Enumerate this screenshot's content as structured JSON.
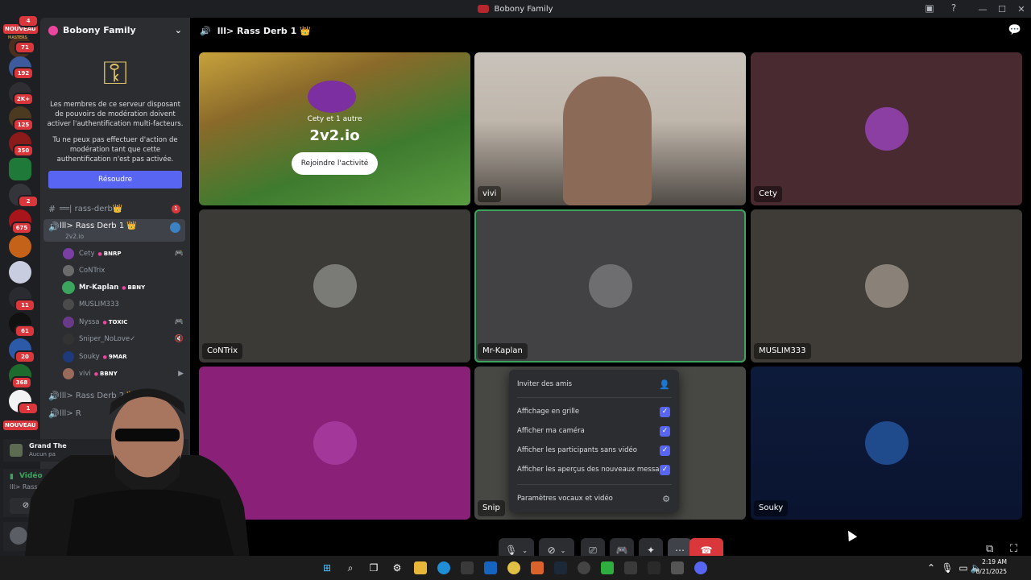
{
  "window": {
    "title": "Bobony Family"
  },
  "rail": {
    "badges": [
      "4",
      "71",
      "192",
      "2K+",
      "125",
      "350",
      "2",
      "675",
      "11",
      "61",
      "20",
      "368",
      "1"
    ],
    "new_labels": [
      "NOUVEAU",
      "NOUVEAU"
    ],
    "tiny_label": "MASTERS"
  },
  "sidebar": {
    "server_name": "Bobony Family",
    "mfa_text_1": "Les membres de ce serveur disposant de pouvoirs de modération doivent activer l'authentification multi-facteurs.",
    "mfa_text_2": "Tu ne peux pas effectuer d'action de modération tant que cette authentification n'est pas activée.",
    "resolve_label": "Résoudre",
    "channels": [
      {
        "name": "══| rass-derb👑",
        "unread": "1"
      },
      {
        "name": "lll> Rass Derb 1 👑",
        "sub": "2v2.io"
      },
      {
        "name": "lll> Rass Derb 2 👑"
      },
      {
        "name": "lll> R"
      }
    ],
    "members": [
      {
        "name": "Cety",
        "tag": "BNRP"
      },
      {
        "name": "CoNTrix",
        "tag": ""
      },
      {
        "name": "Mr-Kaplan",
        "tag": "BBNY"
      },
      {
        "name": "MUSLIM333",
        "tag": ""
      },
      {
        "name": "Nyssa",
        "tag": "TOXIC"
      },
      {
        "name": "Sniper_NoLove✓",
        "tag": ""
      },
      {
        "name": "Souky",
        "tag": "9MAR"
      },
      {
        "name": "vivi",
        "tag": "BBNY"
      }
    ],
    "activity": {
      "title": "Grand The",
      "sub": "Aucun pa"
    },
    "voice": {
      "status": "Vidéo",
      "channel": "lll> Rass D",
      "user": "M"
    }
  },
  "voice_header": {
    "channel": "lll> Rass Derb 1 👑"
  },
  "tiles": {
    "activity": {
      "caption": "Cety et 1 autre",
      "game": "2v2.io",
      "join_label": "Rejoindre l'activité"
    },
    "names": [
      "vivi",
      "Cety",
      "CoNTrix",
      "Mr-Kaplan",
      "MUSLIM333",
      "Snip",
      "Souky"
    ]
  },
  "menu": {
    "invite": "Inviter des amis",
    "options": [
      "Affichage en grille",
      "Afficher ma caméra",
      "Afficher les participants sans vidéo",
      "Afficher les aperçus des nouveaux messa..."
    ],
    "settings": "Paramètres vocaux et vidéo"
  },
  "taskbar": {
    "time": "2:19 AM",
    "date": "8/21/2025"
  },
  "colors": {
    "accent": "#5865f2",
    "danger": "#da373c",
    "speaking": "#3ba55d"
  }
}
